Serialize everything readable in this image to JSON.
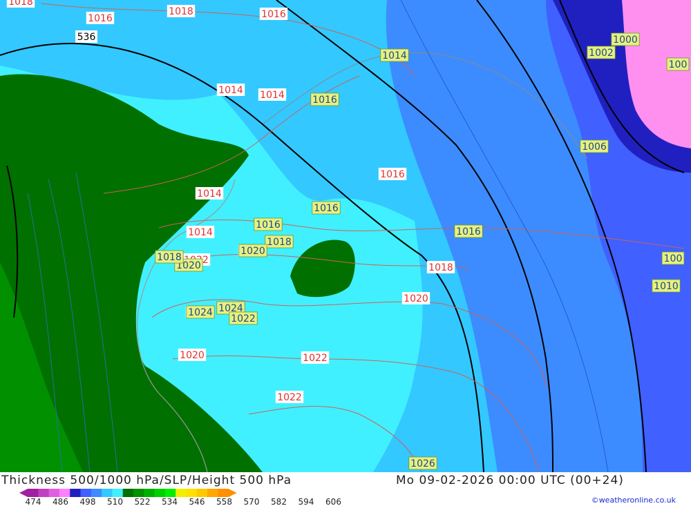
{
  "title_left": "Thickness 500/1000 hPa/SLP/Height 500 hPa",
  "title_right": "Mo 09-02-2026 00:00 UTC (00+24)",
  "credit": "©weatheronline.co.uk",
  "legend": {
    "ticks": [
      "474",
      "486",
      "498",
      "510",
      "522",
      "534",
      "546",
      "558",
      "570",
      "582",
      "594",
      "606"
    ],
    "colors": [
      "#a020a0",
      "#c040c0",
      "#e060e0",
      "#ff80ff",
      "#2020c0",
      "#4060ff",
      "#3c8cff",
      "#33c8ff",
      "#40f0ff",
      "#007000",
      "#009000",
      "#00b000",
      "#00d000",
      "#00f000",
      "#f0f000",
      "#ffe000",
      "#ffc800",
      "#ffa800",
      "#ff9000"
    ]
  },
  "pressure_labels": {
    "red": [
      {
        "text": "1018"
      },
      {
        "text": "1016"
      },
      {
        "text": "1018"
      },
      {
        "text": "1016"
      },
      {
        "text": "1014"
      },
      {
        "text": "1014"
      },
      {
        "text": "1014"
      },
      {
        "text": "1016"
      },
      {
        "text": "1018"
      },
      {
        "text": "1022"
      },
      {
        "text": "1020"
      },
      {
        "text": "1020"
      },
      {
        "text": "1024"
      },
      {
        "text": "1022"
      },
      {
        "text": "1020"
      },
      {
        "text": "1022"
      },
      {
        "text": "1022"
      },
      {
        "text": "1014"
      }
    ],
    "green": [
      {
        "text": "1014"
      },
      {
        "text": "1016"
      },
      {
        "text": "1016"
      },
      {
        "text": "1016"
      },
      {
        "text": "1018"
      },
      {
        "text": "1020"
      },
      {
        "text": "1024"
      },
      {
        "text": "1016"
      },
      {
        "text": "1018"
      },
      {
        "text": "1020"
      },
      {
        "text": "1024"
      },
      {
        "text": "1022"
      },
      {
        "text": "1026"
      },
      {
        "text": "1002"
      },
      {
        "text": "1006"
      },
      {
        "text": "1000"
      },
      {
        "text": "1010"
      },
      {
        "text": "100"
      },
      {
        "text": "100"
      }
    ],
    "height": [
      {
        "text": "536"
      }
    ]
  }
}
